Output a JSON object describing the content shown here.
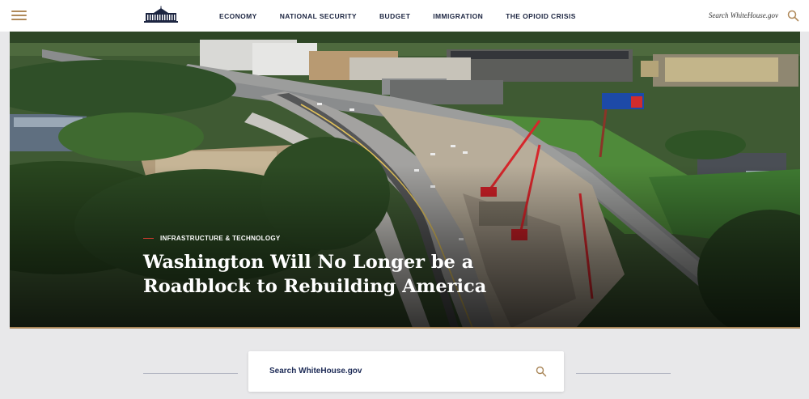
{
  "header": {
    "nav": [
      {
        "label": "ECONOMY"
      },
      {
        "label": "NATIONAL SECURITY"
      },
      {
        "label": "BUDGET"
      },
      {
        "label": "IMMIGRATION"
      },
      {
        "label": "THE OPIOID CRISIS"
      }
    ],
    "search_label": "Search WhiteHouse.gov",
    "icons": {
      "menu": "hamburger-icon",
      "logo": "white-house-logo",
      "search": "search-icon"
    }
  },
  "hero": {
    "category": "INFRASTRUCTURE & TECHNOLOGY",
    "headline_line1": "Washington Will No Longer be a",
    "headline_line2": "Roadblock to Rebuilding America",
    "image_subject": "aerial view of highway interchange construction with red cranes"
  },
  "search": {
    "placeholder": "Search WhiteHouse.gov"
  },
  "colors": {
    "accent_gold": "#a98658",
    "navy": "#1c2541",
    "kicker_red": "#d23b2f",
    "background": "#e8e8ea"
  }
}
